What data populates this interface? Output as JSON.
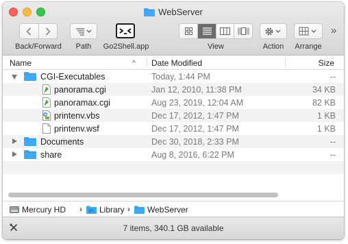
{
  "window": {
    "title": "WebServer"
  },
  "toolbar": {
    "back_forward_label": "Back/Forward",
    "path_label": "Path",
    "go2shell_label": "Go2Shell.app",
    "view_label": "View",
    "action_label": "Action",
    "arrange_label": "Arrange",
    "overflow": "»"
  },
  "columns": {
    "name": "Name",
    "date_modified": "Date Modified",
    "size": "Size",
    "sort_indicator": "^"
  },
  "rows": [
    {
      "name": "CGI-Executables",
      "date": "Today, 1:44 PM",
      "size": "--",
      "kind": "folder",
      "expanded": true,
      "depth": 0
    },
    {
      "name": "panorama.cgi",
      "date": "Jan 12, 2010, 11:38 PM",
      "size": "34 KB",
      "kind": "cgi-file",
      "depth": 1
    },
    {
      "name": "panoramax.cgi",
      "date": "Aug 23, 2019, 12:04 AM",
      "size": "82 KB",
      "kind": "cgi-file",
      "depth": 1
    },
    {
      "name": "printenv.vbs",
      "date": "Dec 17, 2012, 1:47 PM",
      "size": "1 KB",
      "kind": "script-file",
      "depth": 1
    },
    {
      "name": "printenv.wsf",
      "date": "Dec 17, 2012, 1:47 PM",
      "size": "1 KB",
      "kind": "document-file",
      "depth": 1
    },
    {
      "name": "Documents",
      "date": "Dec 30, 2018, 2:33 PM",
      "size": "--",
      "kind": "folder",
      "expanded": false,
      "depth": 0
    },
    {
      "name": "share",
      "date": "Aug 8, 2016, 6:22 PM",
      "size": "--",
      "kind": "folder",
      "expanded": false,
      "depth": 0
    }
  ],
  "pathbar": {
    "items": [
      "Mercury HD",
      "Library",
      "WebServer"
    ],
    "separator": "›"
  },
  "status": {
    "text": "7 items, 340.1 GB available"
  },
  "colors": {
    "folder_blue": "#3fa9f5",
    "close": "#fc605b",
    "minimize": "#fdbc40",
    "maximize": "#34c84a"
  }
}
